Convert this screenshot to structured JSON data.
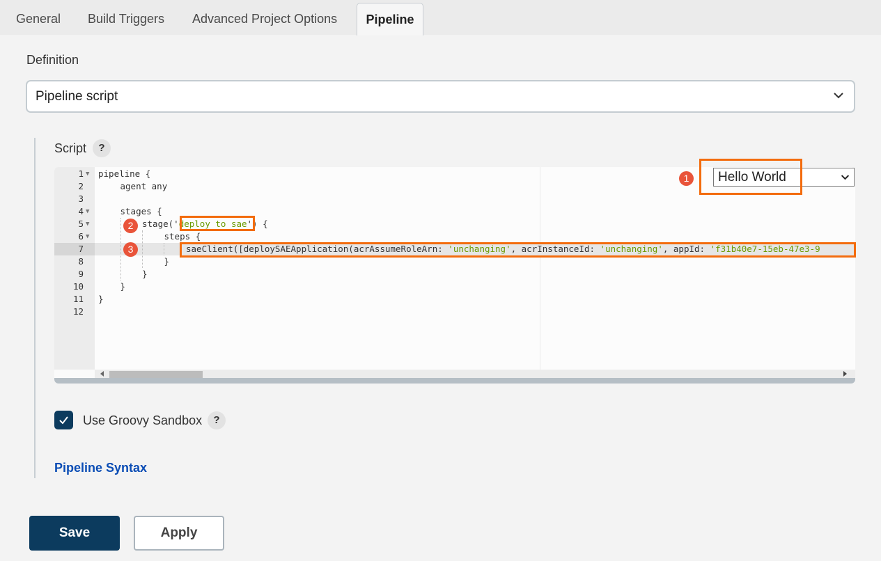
{
  "tabs": [
    {
      "label": "General",
      "active": false
    },
    {
      "label": "Build Triggers",
      "active": false
    },
    {
      "label": "Advanced Project Options",
      "active": false
    },
    {
      "label": "Pipeline",
      "active": true
    }
  ],
  "definition": {
    "label": "Definition",
    "selected": "Pipeline script"
  },
  "script": {
    "label": "Script",
    "help": "?",
    "sample_selected": "Hello World",
    "lines": [
      {
        "n": "1",
        "fold": true,
        "indent": 0,
        "parts": [
          {
            "t": "pipeline {"
          }
        ]
      },
      {
        "n": "2",
        "fold": false,
        "indent": 1,
        "parts": [
          {
            "t": "agent any"
          }
        ]
      },
      {
        "n": "3",
        "fold": false,
        "indent": 0,
        "parts": []
      },
      {
        "n": "4",
        "fold": true,
        "indent": 1,
        "parts": [
          {
            "t": "stages {"
          }
        ]
      },
      {
        "n": "5",
        "fold": true,
        "indent": 2,
        "parts": [
          {
            "t": "stage('"
          },
          {
            "t": "deploy to sae",
            "s": true
          },
          {
            "t": "') {"
          }
        ]
      },
      {
        "n": "6",
        "fold": true,
        "indent": 3,
        "parts": [
          {
            "t": "steps {"
          }
        ]
      },
      {
        "n": "7",
        "fold": false,
        "indent": 4,
        "parts": [
          {
            "t": "saeClient([deploySAEApplication(acrAssumeRoleArn: "
          },
          {
            "t": "'unchanging'",
            "s": true
          },
          {
            "t": ", acrInstanceId: "
          },
          {
            "t": "'unchanging'",
            "s": true
          },
          {
            "t": ", appId: "
          },
          {
            "t": "'f31b40e7-15eb-47e3-9",
            "s": true
          }
        ]
      },
      {
        "n": "8",
        "fold": false,
        "indent": 3,
        "parts": [
          {
            "t": "}"
          }
        ]
      },
      {
        "n": "9",
        "fold": false,
        "indent": 2,
        "parts": [
          {
            "t": "}"
          }
        ]
      },
      {
        "n": "10",
        "fold": false,
        "indent": 1,
        "parts": [
          {
            "t": "}"
          }
        ]
      },
      {
        "n": "11",
        "fold": false,
        "indent": 0,
        "parts": [
          {
            "t": "}"
          }
        ]
      },
      {
        "n": "12",
        "fold": false,
        "indent": 0,
        "parts": []
      }
    ]
  },
  "annotations": [
    "1",
    "2",
    "3"
  ],
  "sandbox": {
    "label": "Use Groovy Sandbox",
    "checked": true,
    "help": "?"
  },
  "links": {
    "pipeline_syntax": "Pipeline Syntax"
  },
  "buttons": {
    "save": "Save",
    "apply": "Apply"
  },
  "colors": {
    "accent": "#0c3b5e",
    "link": "#0b4db5",
    "annotation": "#f36c0e",
    "badge": "#e9543a",
    "string": "#6a9a00"
  }
}
